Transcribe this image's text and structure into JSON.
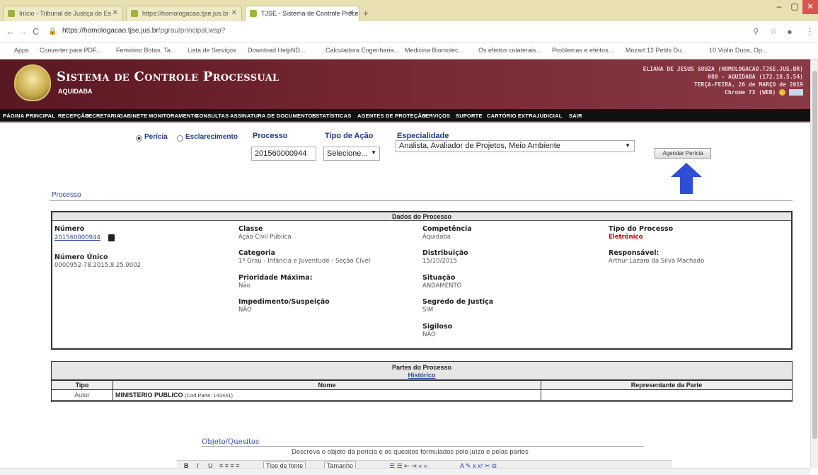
{
  "browser": {
    "tabs": [
      {
        "label": "Início - Tribunal de Justiça do Es"
      },
      {
        "label": "https://homologacao.tjse.jus.br"
      },
      {
        "label": "TJSE - Sistema de Controle Proce"
      }
    ],
    "url_host": "https://homologacao.tjse.jus.br",
    "url_path": "/pgrau/principal.wsp?",
    "bookmarks": [
      "Apps",
      "Converter para PDF...",
      "Feminino Botas, Ta...",
      "Lista de Serviços",
      "Download HelpND...",
      "Calculadora Engenharia...",
      "Medicina Biomolec...",
      "Os efeitos colaterais...",
      "Problemas e efeitos...",
      "Mozart 12 Petits Du...",
      "10 Violin Duos, Op..."
    ]
  },
  "app": {
    "title": "Sistema de Controle Processual",
    "subtitle": "AQUIDABA",
    "user_lines": [
      "ELIANA DE JESUS SOUZA (HOMOLOGACAO.TJSE.JUS.BR)",
      "080 - AQUIDABA (172.18.5.54)",
      "TERÇA-FEIRA, 26 de MARÇO de 2019",
      "Chrome 73 (WEB)"
    ]
  },
  "menu": [
    "PÁGINA PRINCIPAL",
    "RECEPÇÃO",
    "SECRETARIA",
    "GABINETE",
    "MONITORAMENTO",
    "CONSULTAS",
    "ASSINATURA DE DOCUMENTOS",
    "ESTATÍSTICAS",
    "AGENTES DE PROTEÇÃO",
    "SERVIÇOS",
    "SUPORTE",
    "CARTÓRIO EXTRAJUDICIAL",
    "SAIR"
  ],
  "form": {
    "radio_pericia": "Perícia",
    "radio_esclarecimento": "Esclarecimento",
    "processo_label": "Processo",
    "processo_value": "201560000944",
    "tipo_acao_label": "Tipo de Ação",
    "tipo_acao_value": "Selecione...",
    "especialidade_label": "Especialidade",
    "especialidade_value": "Analista, Avaliador de Projetos, Meio Ambiente",
    "agendar_button": "Agendar Perícia"
  },
  "section_link": "Processo",
  "dados": {
    "header": "Dados do Processo",
    "numero_label": "Número",
    "numero_value": "201560000944",
    "numero_unico_label": "Número Único",
    "numero_unico_value": "0000952-78.2015.8.25.0002",
    "classe_label": "Classe",
    "classe_value": "Ação Civil Pública",
    "categoria_label": "Categoria",
    "categoria_value": "1º Grau - Infância e Juventude - Seção Cível",
    "prioridade_label": "Prioridade Máxima:",
    "prioridade_value": "Não",
    "impedimento_label": "Impedimento/Suspeição",
    "impedimento_value": "NÃO",
    "competencia_label": "Competência",
    "competencia_value": "Aquidaba",
    "distribuicao_label": "Distribuição",
    "distribuicao_value": "15/10/2015",
    "situacao_label": "Situação",
    "situacao_value": "ANDAMENTO",
    "segredo_label": "Segredo de Justiça",
    "segredo_value": "SIM",
    "sigiloso_label": "Sigiloso",
    "sigiloso_value": "NÃO",
    "tipo_processo_label": "Tipo do Processo",
    "tipo_processo_value": "Eletrônico",
    "responsavel_label": "Responsável:",
    "responsavel_value": "Arthur Lazaro da Silva Machado"
  },
  "partes": {
    "header": "Partes do Processo",
    "historico": "Histórico",
    "col_tipo": "Tipo",
    "col_nome": "Nome",
    "col_rep": "Representante da Parte",
    "row_tipo": "Autor",
    "row_nome": "MINISTERIO PUBLICO",
    "row_cod": "(Cod.Parte: 143441)"
  },
  "editor": {
    "label": "Objeto/Quesitos",
    "description": "Descreva o objeto da perícia e os quesitos formulados pelo juízo e pelas partes",
    "font_family": "Tipo de fonte",
    "font_size": "Tamanho"
  }
}
